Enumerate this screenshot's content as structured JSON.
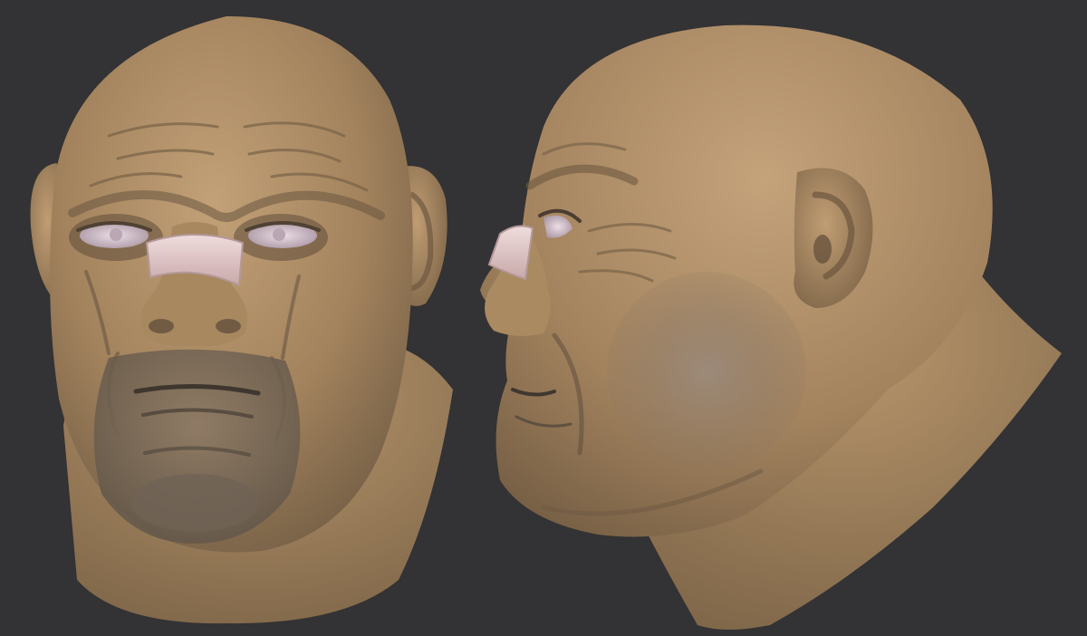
{
  "scene": {
    "background": "#333234",
    "clay_color": "#a6865f",
    "clay_shadow": "#5d5244",
    "clay_highlight": "#c9a880",
    "bandage_color": "#e2c9c9",
    "eye_color": "#d9c7d3",
    "views": [
      {
        "name": "front-view"
      },
      {
        "name": "side-view"
      }
    ]
  }
}
